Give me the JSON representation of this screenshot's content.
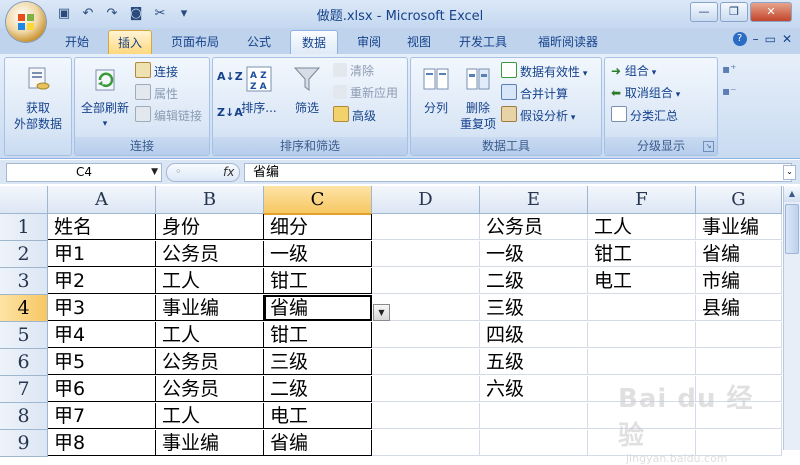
{
  "window": {
    "title": "做题.xlsx - Microsoft Excel"
  },
  "quick_access": {
    "icons": [
      "save-icon",
      "undo-icon",
      "redo-icon",
      "camera-icon",
      "tools-icon",
      "customize-icon"
    ]
  },
  "tabs": [
    "开始",
    "插入",
    "页面布局",
    "公式",
    "数据",
    "审阅",
    "视图",
    "开发工具",
    "福昕阅读器"
  ],
  "active_tab": "数据",
  "ribbon": {
    "groups": {
      "external": {
        "label": "",
        "btn": "获取\n外部数据"
      },
      "connections": {
        "label": "连接",
        "refresh": "全部刷新",
        "connections": "连接",
        "properties": "属性",
        "edit_links": "编辑链接"
      },
      "sort_filter": {
        "label": "排序和筛选",
        "sort_az": "A→Z",
        "sort": "排序...",
        "filter": "筛选",
        "clear": "清除",
        "reapply": "重新应用",
        "advanced": "高级"
      },
      "data_tools": {
        "label": "数据工具",
        "text_to_columns": "分列",
        "remove_dup_1": "删除",
        "remove_dup_2": "重复项",
        "validation": "数据有效性",
        "consolidate": "合并计算",
        "what_if": "假设分析"
      },
      "outline": {
        "label": "分级显示",
        "group": "组合",
        "ungroup": "取消组合",
        "subtotal": "分类汇总"
      }
    }
  },
  "formula_bar": {
    "name_box": "C4",
    "fx": "fx",
    "value": "省编"
  },
  "columns": [
    "A",
    "B",
    "C",
    "D",
    "E",
    "F",
    "G"
  ],
  "selected_column": "C",
  "rows": [
    "1",
    "2",
    "3",
    "4",
    "5",
    "6",
    "7",
    "8",
    "9"
  ],
  "selected_row": "4",
  "cells": {
    "A": [
      "姓名",
      "甲1",
      "甲2",
      "甲3",
      "甲4",
      "甲5",
      "甲6",
      "甲7",
      "甲8"
    ],
    "B": [
      "身份",
      "公务员",
      "工人",
      "事业编",
      "工人",
      "公务员",
      "公务员",
      "工人",
      "事业编"
    ],
    "C": [
      "细分",
      "一级",
      "钳工",
      "省编",
      "钳工",
      "三级",
      "二级",
      "电工",
      "省编"
    ],
    "D": [
      "",
      "",
      "",
      "",
      "",
      "",
      "",
      "",
      ""
    ],
    "E": [
      "公务员",
      "一级",
      "二级",
      "三级",
      "四级",
      "五级",
      "六级",
      "",
      ""
    ],
    "F": [
      "工人",
      "钳工",
      "电工",
      "",
      "",
      "",
      "",
      "",
      ""
    ],
    "G": [
      "事业编",
      "省编",
      "市编",
      "县编",
      "",
      "",
      "",
      "",
      ""
    ]
  },
  "watermark": {
    "line1": "Bai du 经验",
    "line2": "jingyan.baidu.com"
  },
  "colors": {
    "accent": "#15428b",
    "selected_header": "#f7c763",
    "ribbon_bg": "#dbe7f6"
  }
}
